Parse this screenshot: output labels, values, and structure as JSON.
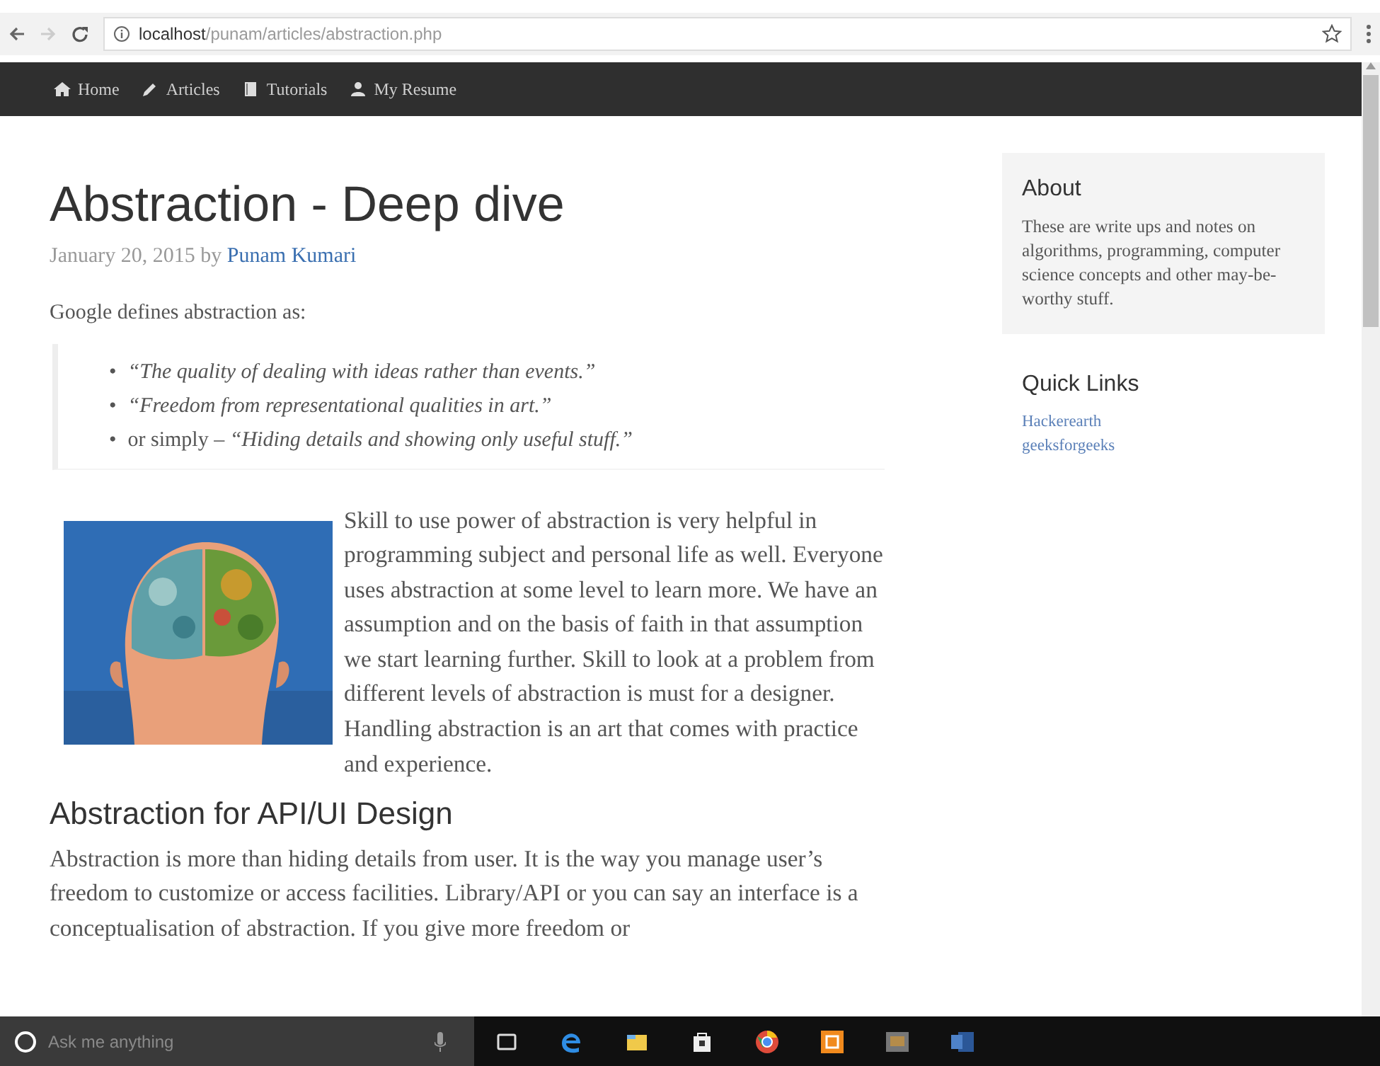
{
  "browser": {
    "back_disabled": false,
    "forward_disabled": true,
    "url": "**localhost**/punam/articles/abstraction.php"
  },
  "navbar": {
    "items": [
      {
        "label": "Home"
      },
      {
        "label": "Articles"
      },
      {
        "label": "Tutorials"
      },
      {
        "label": "My Resume"
      }
    ]
  },
  "article": {
    "title": "Abstraction - Deep dive",
    "date": "January 20, 2015 by",
    "author": "Punam Kumari",
    "intro": "Google defines abstraction as:",
    "quotes": [
      {
        "marker": "•",
        "text": "*“The quality of dealing with ideas rather than events.”*"
      },
      {
        "marker": "•",
        "text": "*“Freedom from representational qualities in art.”*"
      },
      {
        "marker": "•",
        "text": "or simply – *“Hiding details and showing only useful stuff.”*"
      }
    ],
    "paragraph": "Skill to use power of abstraction is very helpful in programming subject and personal life as well. Everyone uses abstraction at some level to learn more. We have an assumption and on the basis of faith in that assumption we start learning further. Skill to look at a problem from different levels of abstraction is must for a designer. Handling abstraction is an art that comes with practice and experience.",
    "subheading": "Abstraction for API/UI Design",
    "paragraph_2": "Abstraction is more than hiding details from user. It is the way you manage user’s freedom to customize or access facilities. Library/API or you can say an interface is a conceptualisation of abstraction. If you give more freedom or"
  },
  "sidebar": {
    "about": {
      "title": "About",
      "text": "These are write ups and notes on algorithms, programming, computer science concepts and other may-be-worthy stuff."
    },
    "quick_links": {
      "title": "Quick Links",
      "links": [
        "Hackerearth",
        "geeksforgeeks"
      ]
    }
  },
  "taskbar": {
    "search_placeholder": "Ask me anything"
  }
}
